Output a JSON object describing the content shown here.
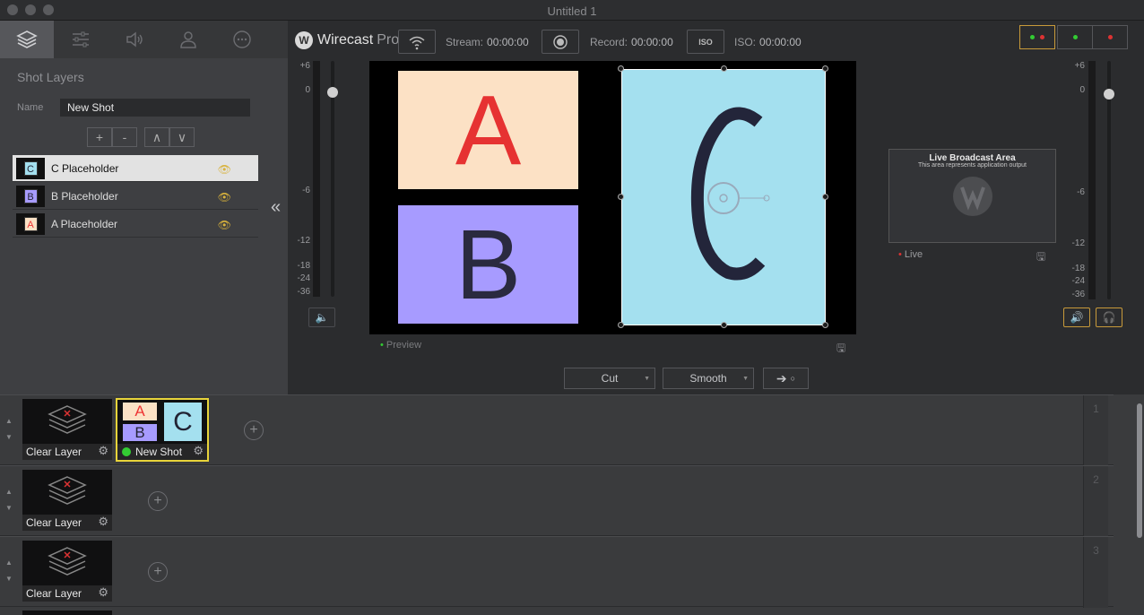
{
  "window": {
    "title": "Untitled 1"
  },
  "left": {
    "tabs": [
      "layers-icon",
      "sliders-icon",
      "speaker-icon",
      "person-icon",
      "more-icon"
    ],
    "title": "Shot Layers",
    "name_label": "Name",
    "name_value": "New Shot",
    "buttons": [
      "+",
      "-",
      "∧",
      "∨"
    ],
    "layers": [
      {
        "thumb": "C",
        "name": "C Placeholder",
        "selected": true
      },
      {
        "thumb": "B",
        "name": "B Placeholder",
        "selected": false
      },
      {
        "thumb": "A",
        "name": "A Placeholder",
        "selected": false
      }
    ],
    "collapse": "«"
  },
  "toolbar": {
    "logo": "Wirecast",
    "logo_pro": "Pro",
    "stream_label": "Stream:",
    "stream_time": "00:00:00",
    "record_label": "Record:",
    "record_time": "00:00:00",
    "iso_btn": "ISO",
    "iso_label": "ISO:",
    "iso_time": "00:00:00"
  },
  "scale_left": [
    "+6",
    "0",
    "-6",
    "-12",
    "-18",
    "-24",
    "-36"
  ],
  "scale_right": [
    "+6",
    "0",
    "-6",
    "-12",
    "-18",
    "-24",
    "-36"
  ],
  "preview": {
    "a": "A",
    "b": "B",
    "c": "C",
    "label": "Preview"
  },
  "live": {
    "title": "Live Broadcast Area",
    "subtitle": "This area represents application output",
    "label": "Live"
  },
  "transitions": {
    "cut": "Cut",
    "smooth": "Smooth"
  },
  "rows": [
    {
      "num": "1",
      "shots": [
        {
          "label": "Clear Layer"
        },
        {
          "label": "New Shot",
          "selected": true
        }
      ]
    },
    {
      "num": "2",
      "shots": [
        {
          "label": "Clear Layer"
        }
      ]
    },
    {
      "num": "3",
      "shots": [
        {
          "label": "Clear Layer"
        }
      ]
    }
  ],
  "colors": {
    "accent": "#e8d43a",
    "a_bg": "#fce1c5",
    "b_bg": "#a79bff",
    "c_bg": "#a4e0ef",
    "live_dot": "#d33",
    "preview_dot": "#3c3"
  }
}
